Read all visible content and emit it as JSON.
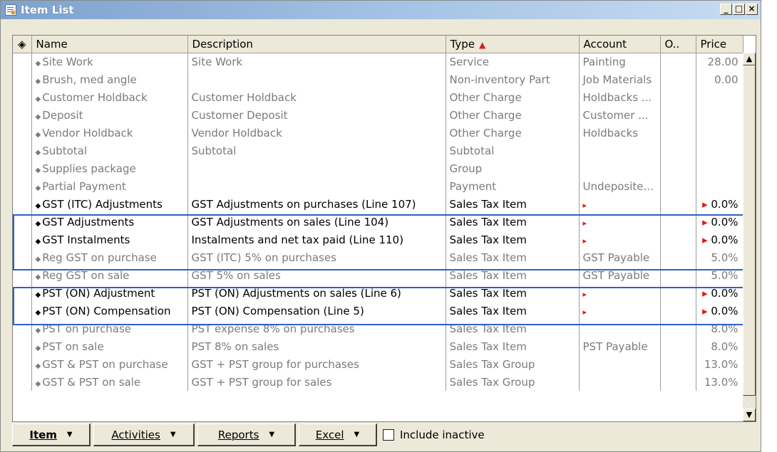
{
  "window": {
    "title": "Item List",
    "controls": {
      "minimize": "_",
      "maximize": "□",
      "close": "×"
    }
  },
  "columns": [
    {
      "key": "icon",
      "label": "◈"
    },
    {
      "key": "name",
      "label": "Name"
    },
    {
      "key": "description",
      "label": "Description"
    },
    {
      "key": "type",
      "label": "Type"
    },
    {
      "key": "account",
      "label": "Account"
    },
    {
      "key": "o",
      "label": "O.."
    },
    {
      "key": "price",
      "label": "Price"
    }
  ],
  "sort": {
    "column": "type",
    "direction": "ascending",
    "indicator": "▲"
  },
  "rows": [
    {
      "name": "Site Work",
      "description": "Site Work",
      "type": "Service",
      "account": "Painting",
      "price": "28.00",
      "highlight": false
    },
    {
      "name": "Brush, med angle",
      "description": "",
      "type": "Non-inventory Part",
      "account": "Job Materials",
      "price": "0.00",
      "highlight": false
    },
    {
      "name": "Customer Holdback",
      "description": "Customer Holdback",
      "type": "Other Charge",
      "account": "Holdbacks ...",
      "price": "",
      "highlight": false
    },
    {
      "name": "Deposit",
      "description": "Customer Deposit",
      "type": "Other Charge",
      "account": "Customer ...",
      "price": "",
      "highlight": false
    },
    {
      "name": "Vendor Holdback",
      "description": "Vendor Holdback",
      "type": "Other Charge",
      "account": "Holdbacks",
      "price": "",
      "highlight": false
    },
    {
      "name": "Subtotal",
      "description": "Subtotal",
      "type": "Subtotal",
      "account": "",
      "price": "",
      "highlight": false
    },
    {
      "name": "Supplies package",
      "description": "",
      "type": "Group",
      "account": "",
      "price": "",
      "highlight": false
    },
    {
      "name": "Partial Payment",
      "description": "",
      "type": "Payment",
      "account": "Undeposite...",
      "price": "",
      "highlight": false
    },
    {
      "name": "GST (ITC) Adjustments",
      "description": "GST Adjustments on purchases (Line 107)",
      "type": "Sales Tax Item",
      "account": "▸",
      "price": "▸ 0.0%",
      "highlight": true
    },
    {
      "name": "GST Adjustments",
      "description": "GST Adjustments on sales (Line 104)",
      "type": "Sales Tax Item",
      "account": "▸",
      "price": "▸ 0.0%",
      "highlight": true
    },
    {
      "name": "GST Instalments",
      "description": "Instalments and net tax paid (Line 110)",
      "type": "Sales Tax Item",
      "account": "▸",
      "price": "▸ 0.0%",
      "highlight": true
    },
    {
      "name": "Reg GST on purchase",
      "description": "GST (ITC) 5% on purchases",
      "type": "Sales Tax Item",
      "account": "GST Payable",
      "price": "5.0%",
      "highlight": false
    },
    {
      "name": "Reg GST on sale",
      "description": "GST 5% on sales",
      "type": "Sales Tax Item",
      "account": "GST Payable",
      "price": "5.0%",
      "highlight": false
    },
    {
      "name": "PST (ON) Adjustment",
      "description": "PST (ON) Adjustments on sales (Line 6)",
      "type": "Sales Tax Item",
      "account": "▸",
      "price": "▸ 0.0%",
      "highlight": true
    },
    {
      "name": "PST (ON) Compensation",
      "description": "PST (ON) Compensation (Line 5)",
      "type": "Sales Tax Item",
      "account": "▸",
      "price": "▸ 0.0%",
      "highlight": true
    },
    {
      "name": "PST on purchase",
      "description": "PST expense 8% on purchases",
      "type": "Sales Tax Item",
      "account": "",
      "price": "8.0%",
      "highlight": false
    },
    {
      "name": "PST on sale",
      "description": "PST 8% on sales",
      "type": "Sales Tax Item",
      "account": "PST Payable",
      "price": "8.0%",
      "highlight": false
    },
    {
      "name": "GST & PST on purchase",
      "description": "GST + PST group for purchases",
      "type": "Sales Tax Group",
      "account": "",
      "price": "13.0%",
      "highlight": false
    },
    {
      "name": "GST & PST on sale",
      "description": "GST + PST group for sales",
      "type": "Sales Tax Group",
      "account": "",
      "price": "13.0%",
      "highlight": false
    }
  ],
  "toolbar": {
    "item_label": "Item",
    "activities_label": "Activities",
    "reports_label": "Reports",
    "excel_label": "Excel",
    "include_inactive_label": "Include inactive",
    "include_inactive_checked": false
  },
  "colors": {
    "highlight_border": "#2f5fc8",
    "inactive_text": "#7b7b7b",
    "sort_arrow": "#d81e1e"
  }
}
